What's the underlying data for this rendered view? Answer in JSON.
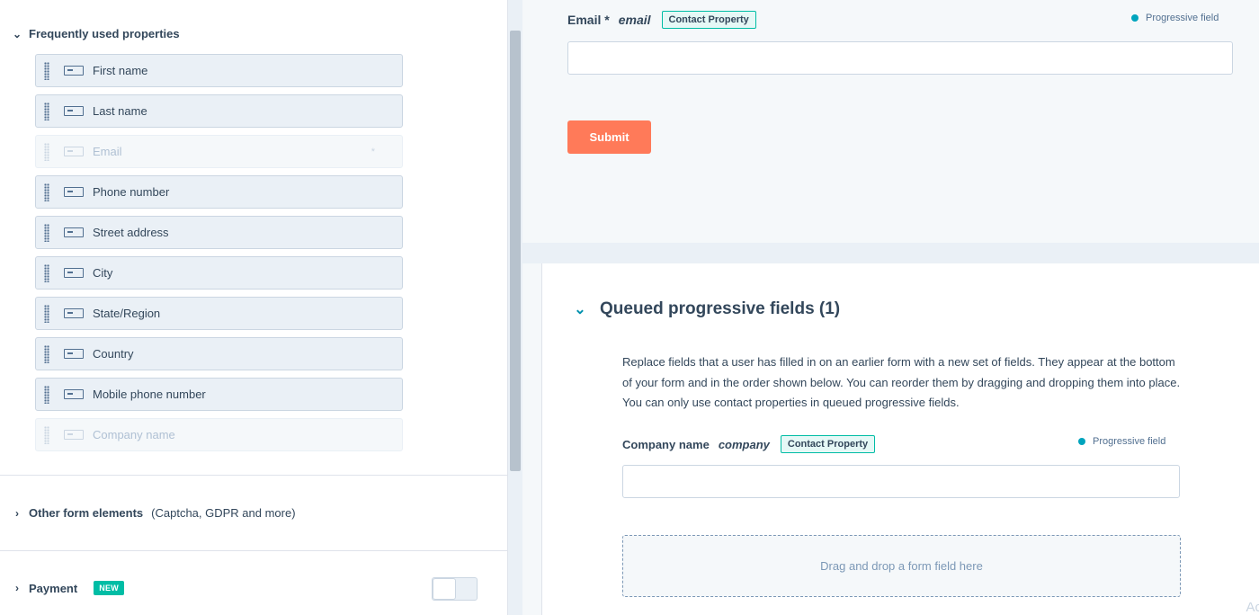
{
  "sidebar": {
    "frequent_section": {
      "title": "Frequently used properties",
      "chevron": "chevron-down-icon"
    },
    "fields": [
      {
        "label": "First name",
        "disabled": false
      },
      {
        "label": "Last name",
        "disabled": false
      },
      {
        "label": "Email",
        "disabled": true,
        "required_marker": "*"
      },
      {
        "label": "Phone number",
        "disabled": false
      },
      {
        "label": "Street address",
        "disabled": false
      },
      {
        "label": "City",
        "disabled": false
      },
      {
        "label": "State/Region",
        "disabled": false
      },
      {
        "label": "Country",
        "disabled": false
      },
      {
        "label": "Mobile phone number",
        "disabled": false
      },
      {
        "label": "Company name",
        "disabled": true
      }
    ],
    "other_section": {
      "title": "Other form elements",
      "subtitle": "(Captcha, GDPR and more)",
      "chevron": "chevron-right-icon"
    },
    "payment_section": {
      "title": "Payment",
      "badge": "NEW",
      "toggle_on": false,
      "chevron": "chevron-right-icon"
    }
  },
  "form": {
    "email_field": {
      "label": "Email *",
      "property": "email",
      "tag": "Contact Property",
      "progressive_label": "Progressive field",
      "value": ""
    },
    "submit_label": "Submit"
  },
  "queue": {
    "title": "Queued progressive fields (1)",
    "description": "Replace fields that a user has filled in on an earlier form with a new set of fields. They appear at the bottom of your form and in the order shown below. You can reorder them by dragging and dropping them into place. You can only use contact properties in queued progressive fields.",
    "company_field": {
      "label": "Company name",
      "property": "company",
      "tag": "Contact Property",
      "progressive_label": "Progressive field",
      "value": ""
    },
    "drop_zone_text": "Drag and drop a form field here"
  },
  "corner_text": "Ac",
  "colors": {
    "accent_teal": "#00bda5",
    "progressive_dot": "#00a4bd",
    "submit_orange": "#ff7a59"
  }
}
